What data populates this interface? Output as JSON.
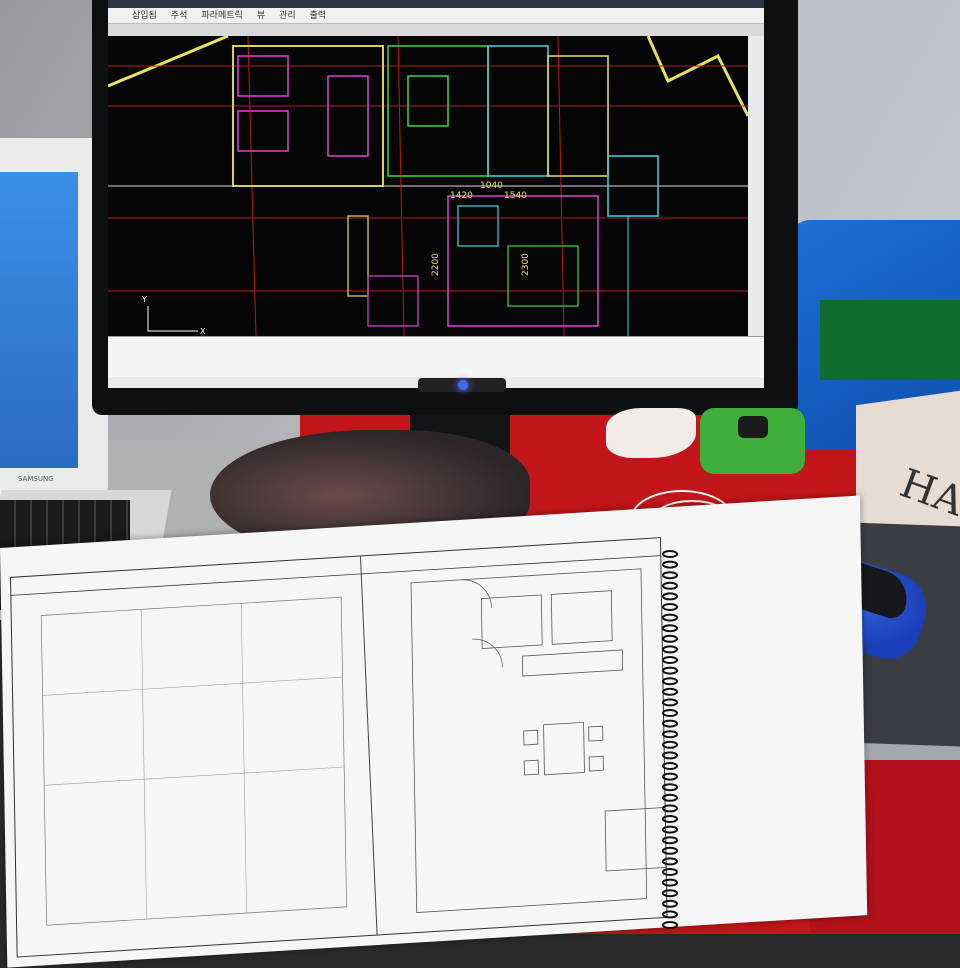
{
  "monitor": {
    "ribbon_tabs": [
      "삽입됨",
      "주석",
      "파라메트릭",
      "뷰",
      "관리",
      "출력"
    ],
    "status_text": "",
    "cad_labels": [
      "1420",
      "1540",
      "2200",
      "1040",
      "2300"
    ]
  },
  "laptop": {
    "brand": "SAMSUNG"
  },
  "book": {
    "spine_text": "HA"
  },
  "sheet": {
    "title": "",
    "caption": ""
  },
  "colors": {
    "desk": "#c2161a",
    "mouse": "#2a56d8",
    "tape_measure": "#3fae3a",
    "cad_background": "#050505"
  }
}
